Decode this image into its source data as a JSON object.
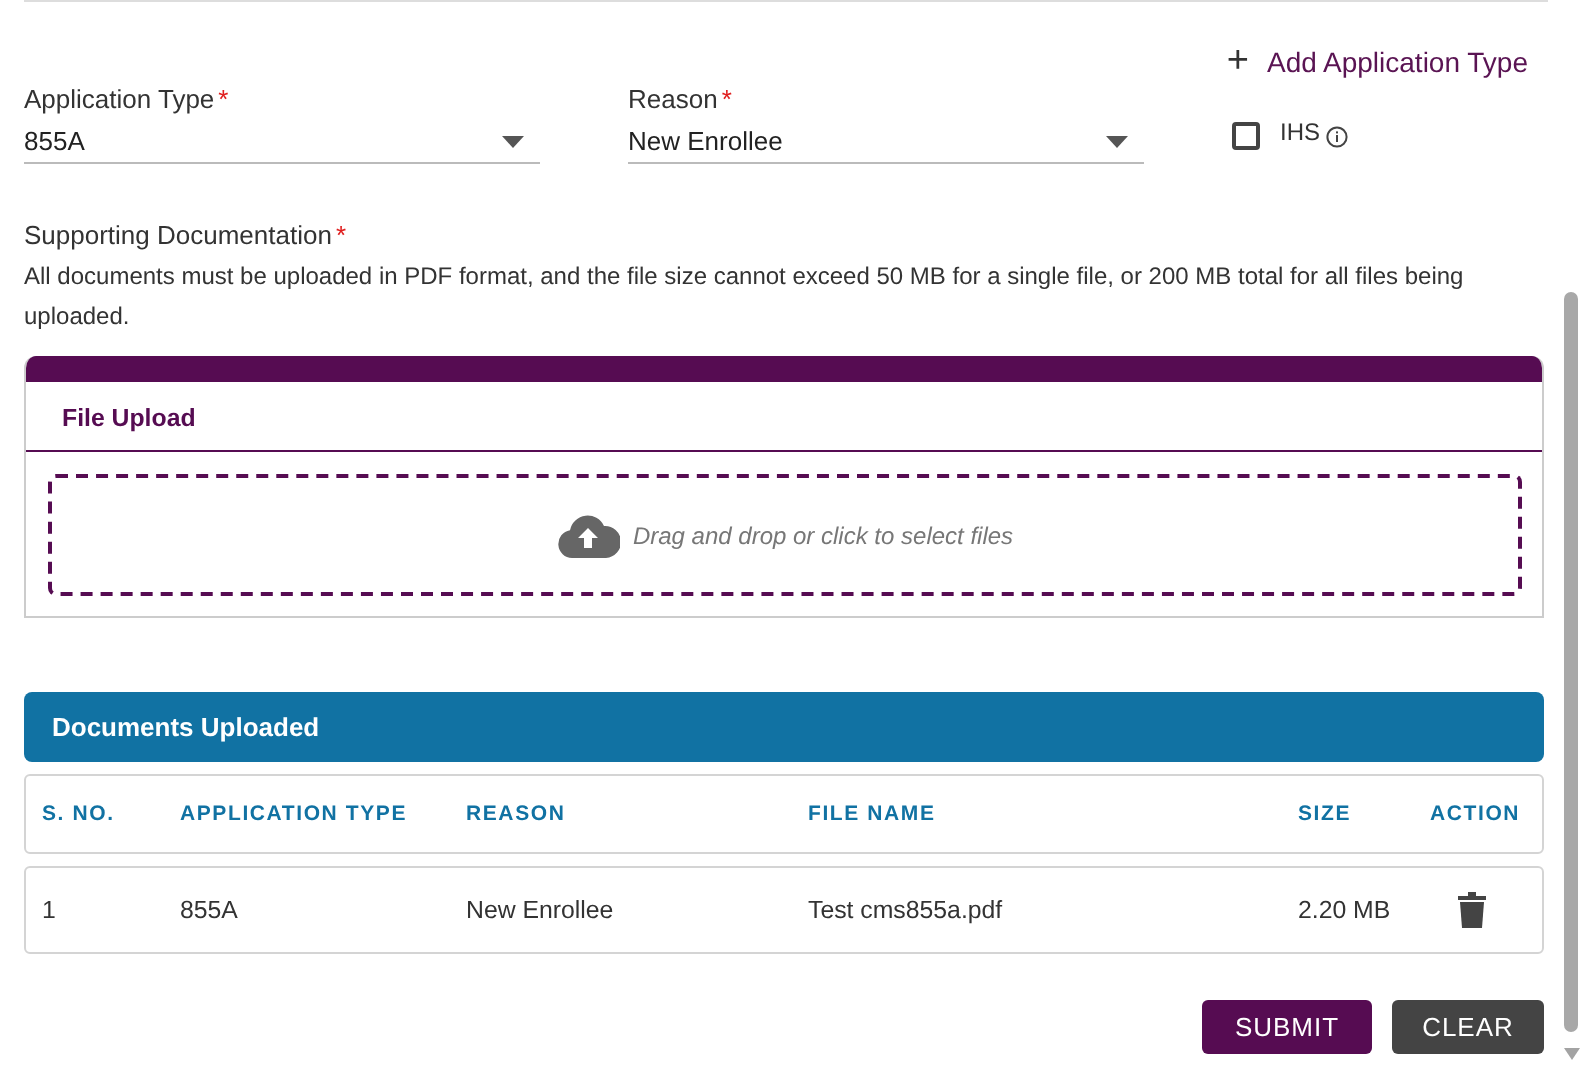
{
  "add_button": {
    "icon": "+",
    "label": "Add Application Type"
  },
  "fields": [
    {
      "label": "Application Type",
      "required_mark": "*",
      "value": "855A"
    },
    {
      "label": "Reason",
      "required_mark": "*",
      "value": "New Enrollee"
    }
  ],
  "ihs_checkbox": {
    "label": "IHS",
    "checked": false
  },
  "supporting": {
    "label": "Supporting Documentation",
    "required_mark": "*",
    "note": "All documents must be uploaded in PDF format, and the file size cannot exceed 50 MB for a single file, or 200 MB total for all files being uploaded."
  },
  "upload_panel": {
    "title": "File Upload",
    "dropzone_text": "Drag and drop or click to select files"
  },
  "documents": {
    "title": "Documents Uploaded",
    "columns": [
      "S. NO.",
      "APPLICATION TYPE",
      "REASON",
      "FILE NAME",
      "SIZE",
      "ACTION"
    ],
    "rows": [
      {
        "s_no": "1",
        "application_type": "855A",
        "reason": "New Enrollee",
        "file_name": "Test cms855a.pdf",
        "size": "2.20 MB"
      }
    ]
  },
  "buttons": [
    {
      "kind": "primary",
      "label": "SUBMIT"
    },
    {
      "kind": "secondary",
      "label": "CLEAR"
    }
  ]
}
